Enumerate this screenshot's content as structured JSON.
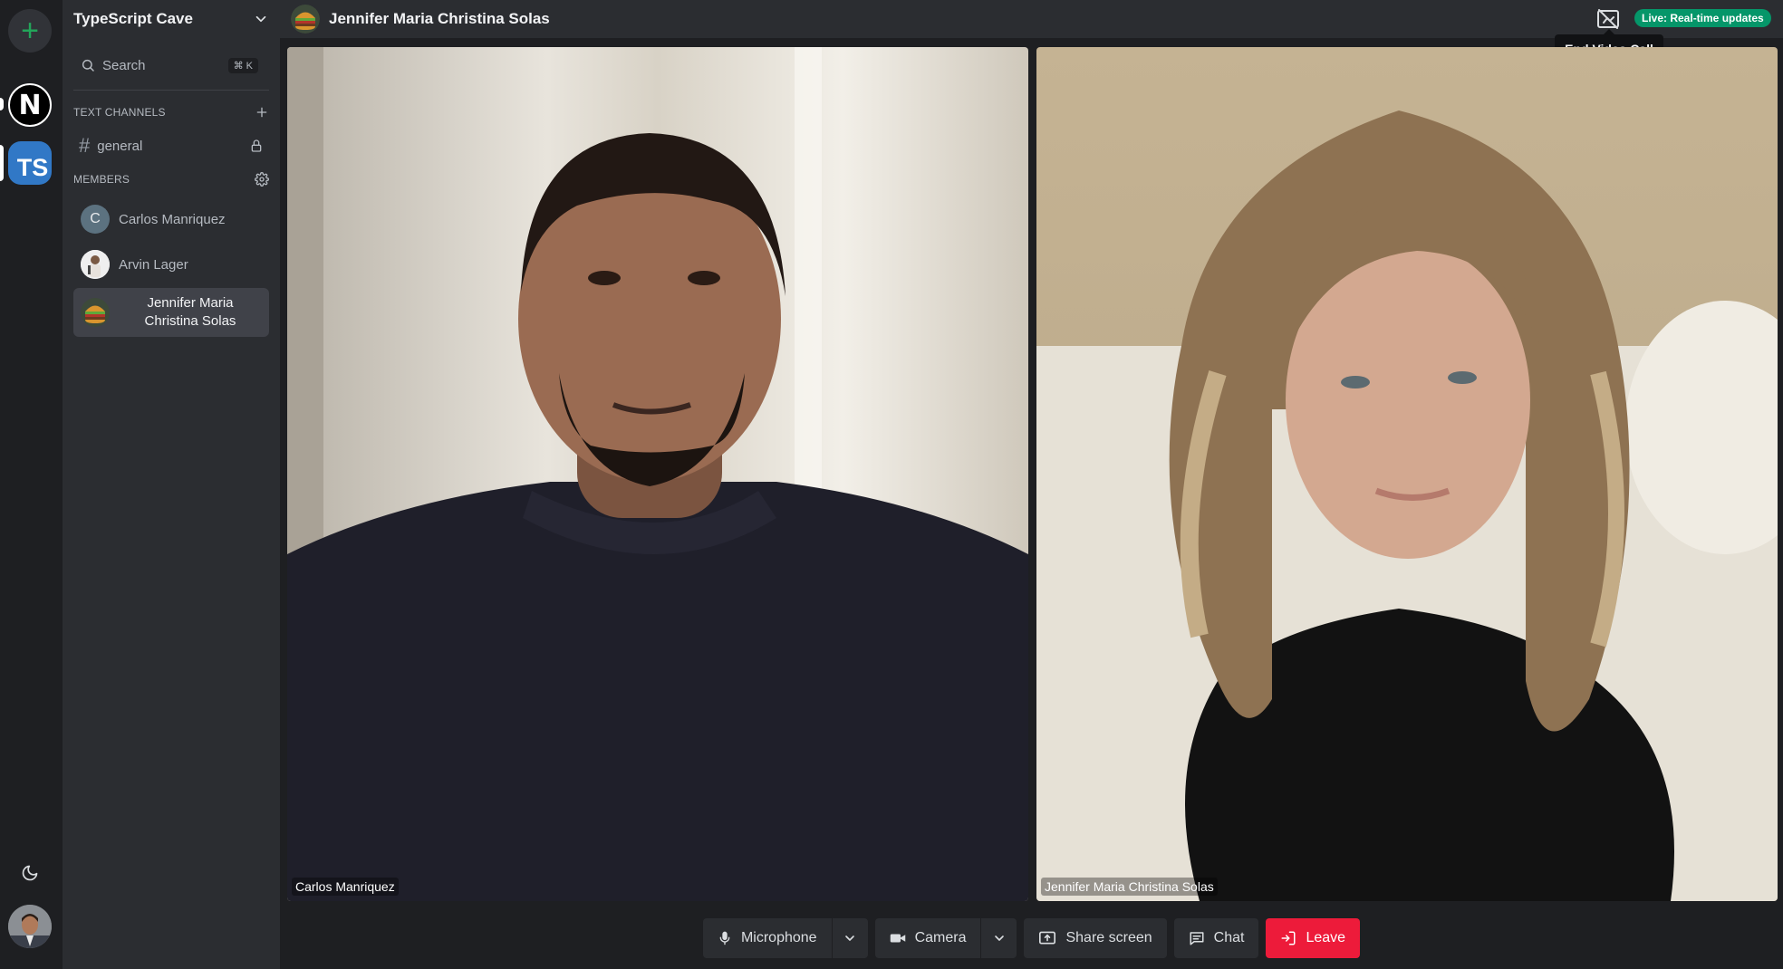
{
  "rail": {
    "servers": [
      {
        "icon": "nextjs-logo",
        "glyph": "N"
      },
      {
        "icon": "typescript-logo",
        "glyph": "TS"
      }
    ]
  },
  "sidebar": {
    "server_name": "TypeScript Cave",
    "search": {
      "label": "Search",
      "shortcut": "⌘ K"
    },
    "text_channels_title": "TEXT CHANNELS",
    "channels": [
      {
        "name": "general",
        "locked": true
      }
    ],
    "members_title": "MEMBERS",
    "members": [
      {
        "name": "Carlos Manriquez",
        "initial": "C"
      },
      {
        "name": "Arvin Lager"
      },
      {
        "name": "Jennifer Maria Christina Solas",
        "active": true
      }
    ]
  },
  "header": {
    "title": "Jennifer Maria Christina Solas",
    "live_badge": "Live: Real-time updates",
    "tooltip": "End Video Call"
  },
  "video": {
    "participants": [
      {
        "name": "Carlos Manriquez"
      },
      {
        "name": "Jennifer Maria Christina Solas"
      }
    ]
  },
  "controls": {
    "microphone": "Microphone",
    "camera": "Camera",
    "share_screen": "Share screen",
    "chat": "Chat",
    "leave": "Leave"
  },
  "colors": {
    "accent_green": "#23a55a",
    "live_badge": "#059669",
    "leave_red": "#ed1b3a",
    "typescript_blue": "#3178c6"
  }
}
